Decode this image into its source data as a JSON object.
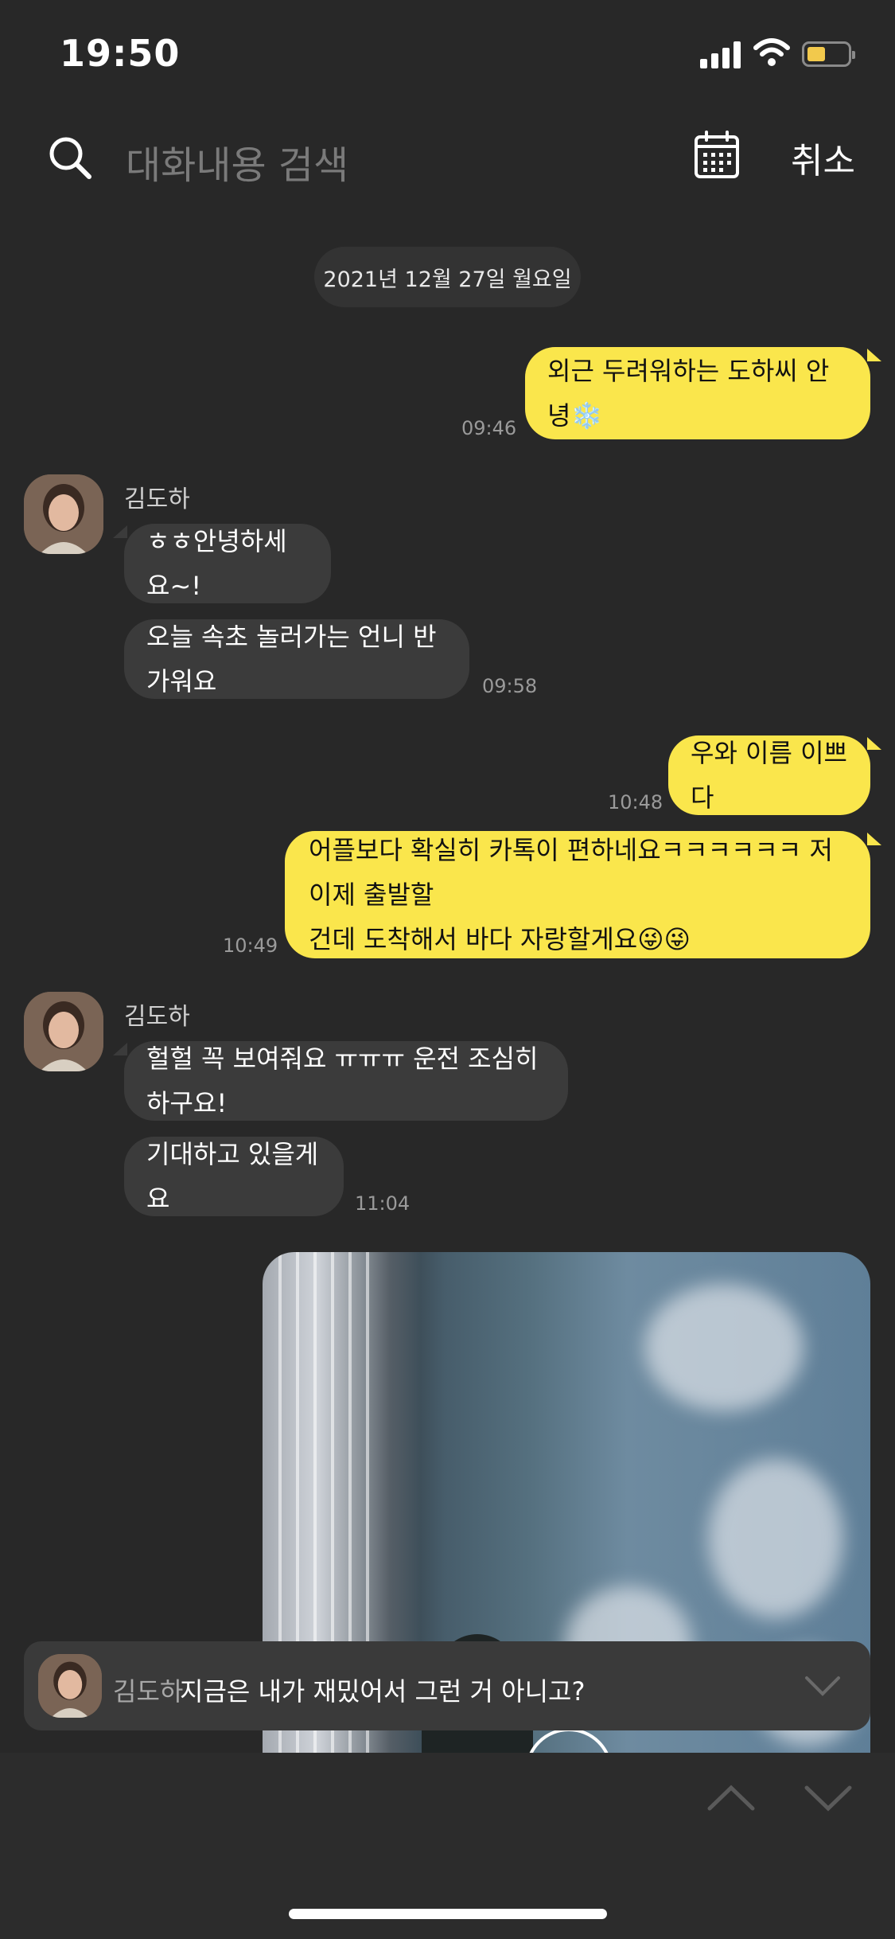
{
  "status_bar": {
    "time": "19:50",
    "battery_color": "#f2c94c"
  },
  "header": {
    "search_placeholder": "대화내용 검색",
    "calendar_icon": "calendar-icon",
    "cancel_label": "취소"
  },
  "date_pill": "2021년 12월 27일 월요일",
  "messages": {
    "m1": {
      "text": "외근 두려워하는 도하씨 안녕❄️",
      "time": "09:46"
    },
    "sender1": "김도하",
    "m2": {
      "text": "ㅎㅎ안녕하세요~!"
    },
    "m3": {
      "text": "오늘 속초 놀러가는 언니 반가워요",
      "time": "09:58"
    },
    "m4": {
      "text": "우와 이름 이쁘다",
      "time": "10:48"
    },
    "m5": {
      "line1": "어플보다 확실히 카톡이 편하네요ㅋㅋㅋㅋㅋㅋ 저 이제 출발할",
      "line2": "건데 도착해서 바다 자랑할게요😜😜",
      "time": "10:49"
    },
    "sender2": "김도하",
    "m6": {
      "text": "헐헐 꼭 보여줘요 ㅠㅠㅠ 운전 조심히 하구요!"
    },
    "m7": {
      "text": "기대하고 있을게요",
      "time": "11:04"
    }
  },
  "search_result": {
    "name": "김도하",
    "text": "지금은 내가 재밌어서 그런 거 아니고?"
  },
  "colors": {
    "my_bubble": "#fae64c",
    "other_bubble": "#3b3b3b",
    "background": "#282828"
  }
}
